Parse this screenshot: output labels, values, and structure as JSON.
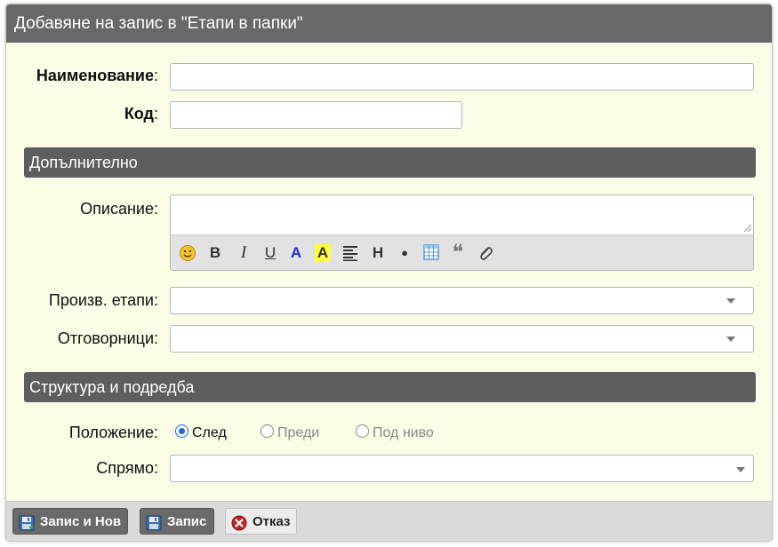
{
  "dialog": {
    "title": "Добавяне на запис в \"Етапи в папки\""
  },
  "fields": {
    "name_label": "Наименование",
    "code_label": "Код",
    "colon": ":"
  },
  "sections": {
    "additional": "Допълнително",
    "structure": "Структура и подредба"
  },
  "additional": {
    "description_label": "Описание:",
    "toolbar": [
      {
        "name": "emoji-icon",
        "glyph": "☺"
      },
      {
        "name": "bold-button",
        "glyph": "B"
      },
      {
        "name": "italic-button",
        "glyph": "I"
      },
      {
        "name": "underline-button",
        "glyph": "U"
      },
      {
        "name": "text-color-button",
        "glyph": "A"
      },
      {
        "name": "highlight-button",
        "glyph": "A"
      },
      {
        "name": "align-icon",
        "glyph": "≡"
      },
      {
        "name": "heading-button",
        "glyph": "H"
      },
      {
        "name": "bullet-button",
        "glyph": "●"
      },
      {
        "name": "table-icon",
        "glyph": "▦"
      },
      {
        "name": "quote-icon",
        "glyph": "❝"
      },
      {
        "name": "attachment-icon",
        "glyph": "⌀"
      }
    ],
    "prod_stages_label": "Произв. етапи:",
    "responsible_label": "Отговорници:"
  },
  "structure": {
    "position_label": "Положение:",
    "options": [
      "След",
      "Преди",
      "Под ниво"
    ],
    "selected": "След",
    "relative_label": "Спрямо:"
  },
  "footer": {
    "save_new": "Запис и Нов",
    "save": "Запис",
    "cancel": "Отказ"
  },
  "colors": {
    "title_bg": "#686868",
    "body_bg": "#fbfbe6",
    "accent": "#1b6ad8",
    "cancel_red": "#c0262b"
  }
}
